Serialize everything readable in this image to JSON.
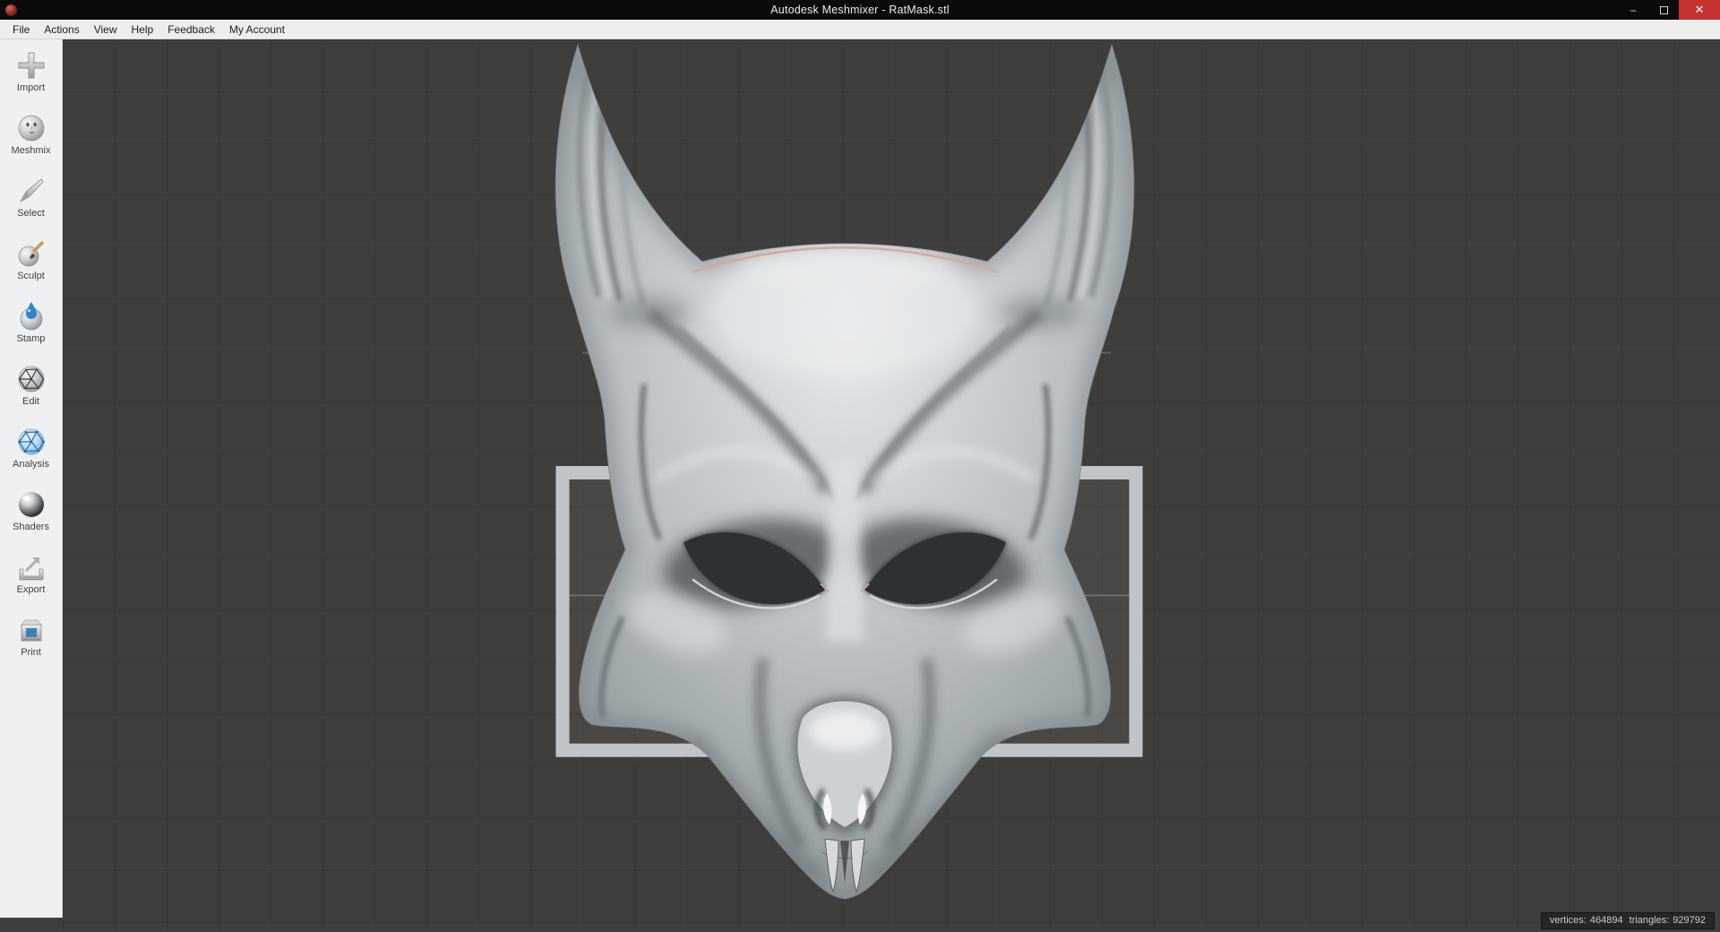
{
  "window": {
    "title": "Autodesk Meshmixer - RatMask.stl",
    "controls": {
      "minimize": "–",
      "maximize": "",
      "close": "✕"
    }
  },
  "menu": {
    "items": [
      {
        "label": "File"
      },
      {
        "label": "Actions"
      },
      {
        "label": "View"
      },
      {
        "label": "Help"
      },
      {
        "label": "Feedback"
      },
      {
        "label": "My Account"
      }
    ]
  },
  "toolbar": {
    "items": [
      {
        "label": "Import",
        "icon": "import-plus-icon"
      },
      {
        "label": "Meshmix",
        "icon": "meshmix-face-sphere-icon"
      },
      {
        "label": "Select",
        "icon": "select-brush-icon"
      },
      {
        "label": "Sculpt",
        "icon": "sculpt-sphere-pencil-icon"
      },
      {
        "label": "Stamp",
        "icon": "stamp-sphere-drop-icon"
      },
      {
        "label": "Edit",
        "icon": "edit-wireframe-sphere-icon"
      },
      {
        "label": "Analysis",
        "icon": "analysis-blue-wireframe-sphere-icon"
      },
      {
        "label": "Shaders",
        "icon": "shaders-glossy-sphere-icon"
      },
      {
        "label": "Export",
        "icon": "export-arrow-icon"
      },
      {
        "label": "Print",
        "icon": "print-printer-icon"
      }
    ]
  },
  "viewport": {
    "status": {
      "vertices_label": "vertices:",
      "vertices_value": "464894",
      "triangles_label": "triangles:",
      "triangles_value": "929792"
    }
  },
  "colors": {
    "titlebar": "#0b0b0b",
    "close_button_red": "#c63131",
    "menu_bg": "#ededee",
    "toolbar_bg": "#eff0f1",
    "viewport_bg": "#3e3e3e",
    "grid_line": "#353535",
    "print_bed_frame": "#c1c5c8",
    "model_gray": "#c2c7ca",
    "selection_outline_pink": "#dba798",
    "stamp_analysis_blue": "#2f86c8"
  }
}
